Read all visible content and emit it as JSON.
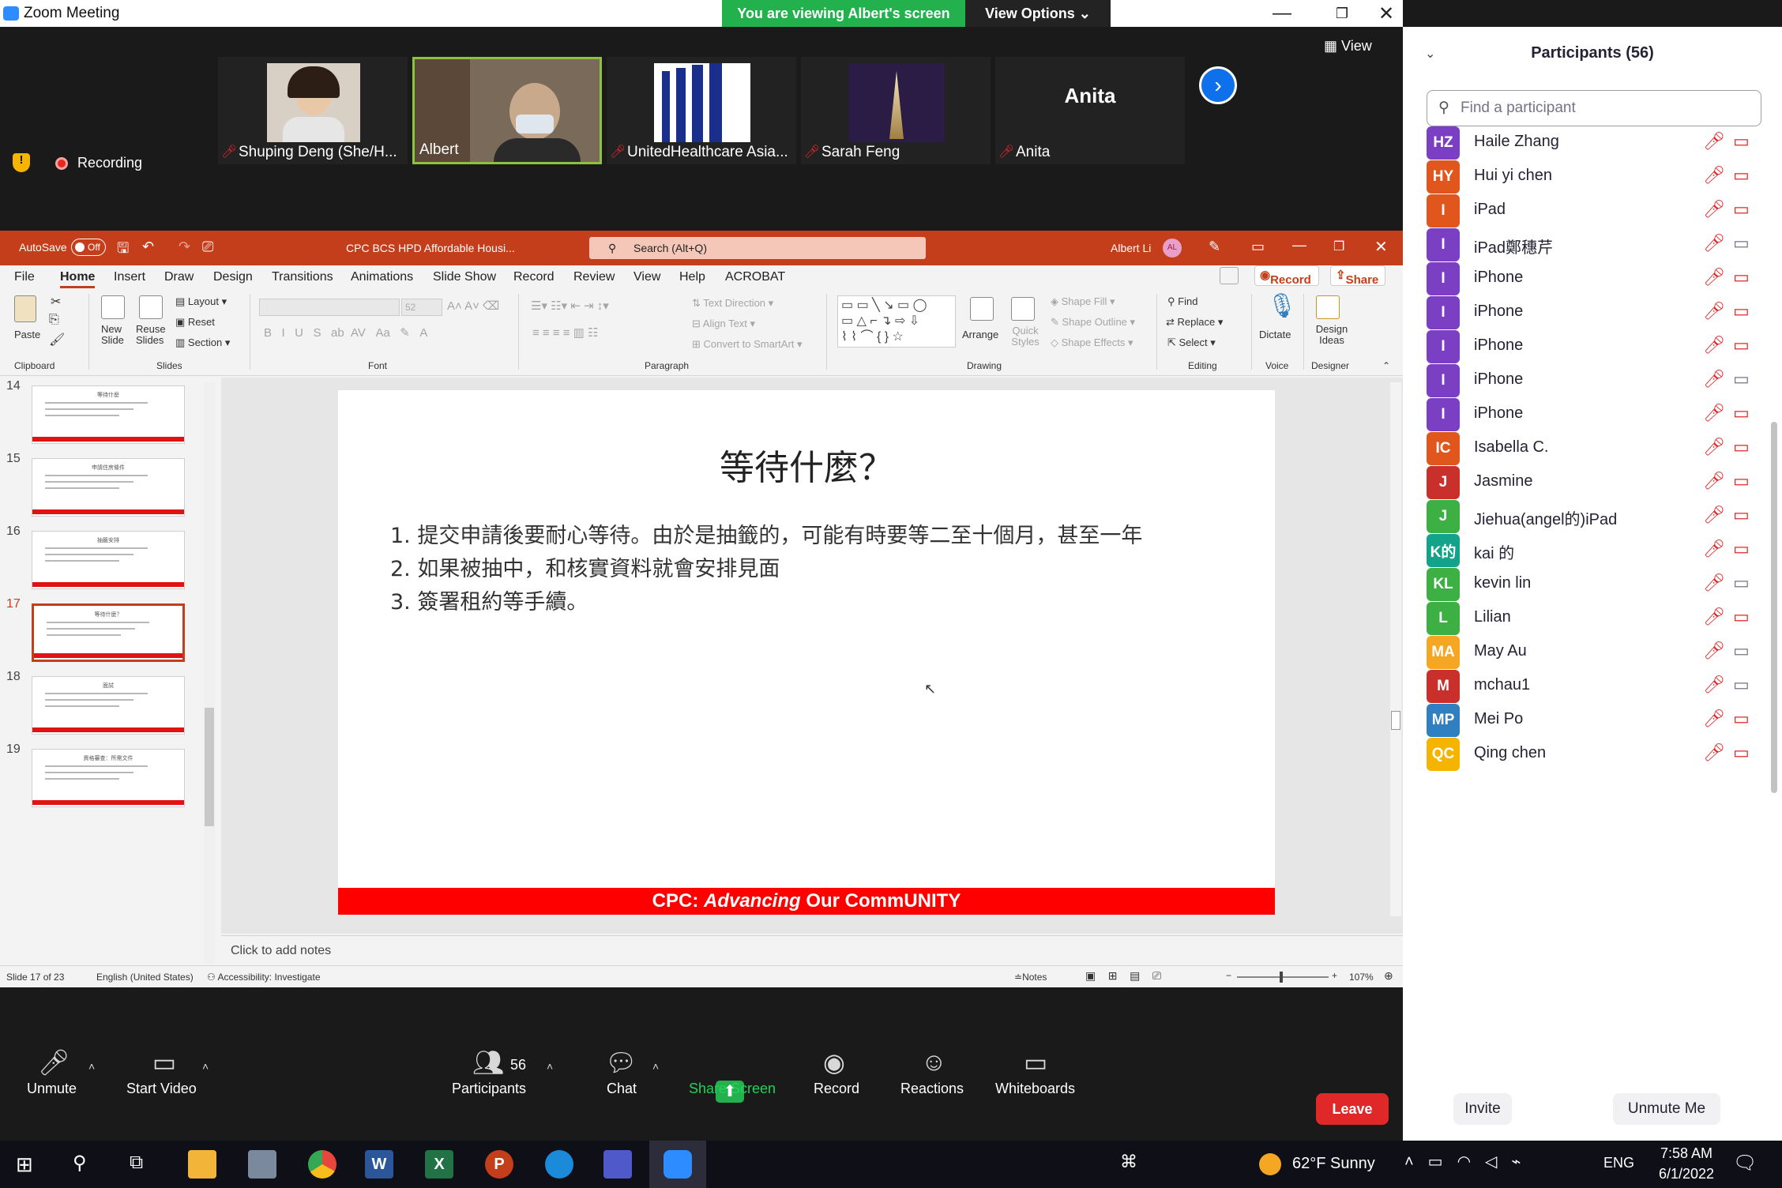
{
  "zoom": {
    "window_title": "Zoom Meeting",
    "viewing_banner": "You are viewing Albert's screen",
    "view_options": "View Options ⌄",
    "view_button": "View",
    "recording_label": "Recording",
    "video_tiles": [
      {
        "name": "Shuping Deng (She/H...",
        "muted": true
      },
      {
        "name": "Albert",
        "muted": false
      },
      {
        "name": "UnitedHealthcare Asia...",
        "muted": true
      },
      {
        "name": "Sarah Feng",
        "muted": true
      },
      {
        "name": "Anita",
        "muted": true,
        "display_text": "Anita"
      }
    ],
    "toolbar": {
      "unmute": "Unmute",
      "start_video": "Start Video",
      "participants": "Participants",
      "participants_count": "56",
      "chat": "Chat",
      "share_screen": "Share Screen",
      "record": "Record",
      "reactions": "Reactions",
      "whiteboards": "Whiteboards",
      "leave": "Leave"
    },
    "panel": {
      "title": "Participants (56)",
      "search_placeholder": "Find a participant",
      "invite": "Invite",
      "unmute_me": "Unmute Me",
      "participants": [
        {
          "initials": "HZ",
          "name": "Haile Zhang",
          "color": "#7b3fc4",
          "video": "off"
        },
        {
          "initials": "HY",
          "name": "Hui yi chen",
          "color": "#e0561c",
          "video": "off"
        },
        {
          "initials": "I",
          "name": "iPad",
          "color": "#e0561c",
          "video": "off"
        },
        {
          "initials": "I",
          "name": "iPad鄭穗芹",
          "color": "#7b3fc4",
          "video": "on"
        },
        {
          "initials": "I",
          "name": "iPhone",
          "color": "#7b3fc4",
          "video": "off"
        },
        {
          "initials": "I",
          "name": "iPhone",
          "color": "#7b3fc4",
          "video": "off"
        },
        {
          "initials": "I",
          "name": "iPhone",
          "color": "#7b3fc4",
          "video": "off"
        },
        {
          "initials": "I",
          "name": "iPhone",
          "color": "#7b3fc4",
          "video": "on"
        },
        {
          "initials": "I",
          "name": "iPhone",
          "color": "#7b3fc4",
          "video": "off"
        },
        {
          "initials": "IC",
          "name": "Isabella C.",
          "color": "#e0561c",
          "video": "off"
        },
        {
          "initials": "J",
          "name": "Jasmine",
          "color": "#c9302c",
          "video": "off"
        },
        {
          "initials": "J",
          "name": "Jiehua(angel的)iPad",
          "color": "#3cb043",
          "video": "off"
        },
        {
          "initials": "K的",
          "name": "kai 的",
          "color": "#12a38a",
          "video": "off"
        },
        {
          "initials": "KL",
          "name": "kevin lin",
          "color": "#3cb043",
          "video": "on"
        },
        {
          "initials": "L",
          "name": "Lilian",
          "color": "#3cb043",
          "video": "off"
        },
        {
          "initials": "MA",
          "name": "May Au",
          "color": "#f5a623",
          "video": "on"
        },
        {
          "initials": "M",
          "name": "mchau1",
          "color": "#c9302c",
          "video": "on"
        },
        {
          "initials": "MP",
          "name": "Mei Po",
          "color": "#2f7fc1",
          "video": "off"
        },
        {
          "initials": "QC",
          "name": "Qing chen",
          "color": "#f5b400",
          "video": "off"
        }
      ]
    }
  },
  "powerpoint": {
    "autosave": "AutoSave",
    "autosave_state": "Off",
    "file_title": "CPC BCS HPD Affordable Housi...",
    "search_placeholder": "Search (Alt+Q)",
    "user_name": "Albert Li",
    "user_initials": "AL",
    "tabs": [
      "File",
      "Home",
      "Insert",
      "Draw",
      "Design",
      "Transitions",
      "Animations",
      "Slide Show",
      "Record",
      "Review",
      "View",
      "Help",
      "ACROBAT"
    ],
    "record_btn": "Record",
    "share_btn": "Share",
    "ribbon": {
      "paste": "Paste",
      "clipboard": "Clipboard",
      "new_slide": "New Slide",
      "reuse_slides": "Reuse Slides",
      "layout": "Layout",
      "reset": "Reset",
      "section": "Section",
      "slides": "Slides",
      "font_size": "52",
      "font": "Font",
      "text_direction": "Text Direction",
      "align_text": "Align Text",
      "convert_smartart": "Convert to SmartArt",
      "paragraph": "Paragraph",
      "arrange": "Arrange",
      "quick_styles": "Quick Styles",
      "shape_fill": "Shape Fill",
      "shape_outline": "Shape Outline",
      "shape_effects": "Shape Effects",
      "drawing": "Drawing",
      "find": "Find",
      "replace": "Replace",
      "select": "Select",
      "editing": "Editing",
      "dictate": "Dictate",
      "voice": "Voice",
      "design_ideas": "Design Ideas",
      "designer": "Designer"
    },
    "thumbnails": [
      {
        "num": "14",
        "title": "等待什麼"
      },
      {
        "num": "15",
        "title": "申請住房條件"
      },
      {
        "num": "16",
        "title": "抽籤安排"
      },
      {
        "num": "17",
        "title": "等待什麼？",
        "selected": true
      },
      {
        "num": "18",
        "title": "面試"
      },
      {
        "num": "19",
        "title": "資格審查：所需文件"
      }
    ],
    "slide": {
      "title": "等待什麼？",
      "items": [
        "1.  提交申請後要耐心等待。由於是抽籤的，可能有時要等二至十個月，甚至一年",
        "2.  如果被抽中，和核實資料就會安排見面",
        "3.  簽署租約等手續。"
      ],
      "footer_prefix": "CPC: ",
      "footer_italic": "Advancing",
      "footer_suffix": " Our CommUNITY"
    },
    "notes_placeholder": "Click to add notes",
    "status": {
      "slide_counter": "Slide 17 of 23",
      "language": "English (United States)",
      "accessibility": "Accessibility: Investigate",
      "notes": "Notes",
      "zoom": "107%"
    }
  },
  "taskbar": {
    "weather": "62°F  Sunny",
    "language": "ENG",
    "time": "7:58 AM",
    "date": "6/1/2022"
  }
}
